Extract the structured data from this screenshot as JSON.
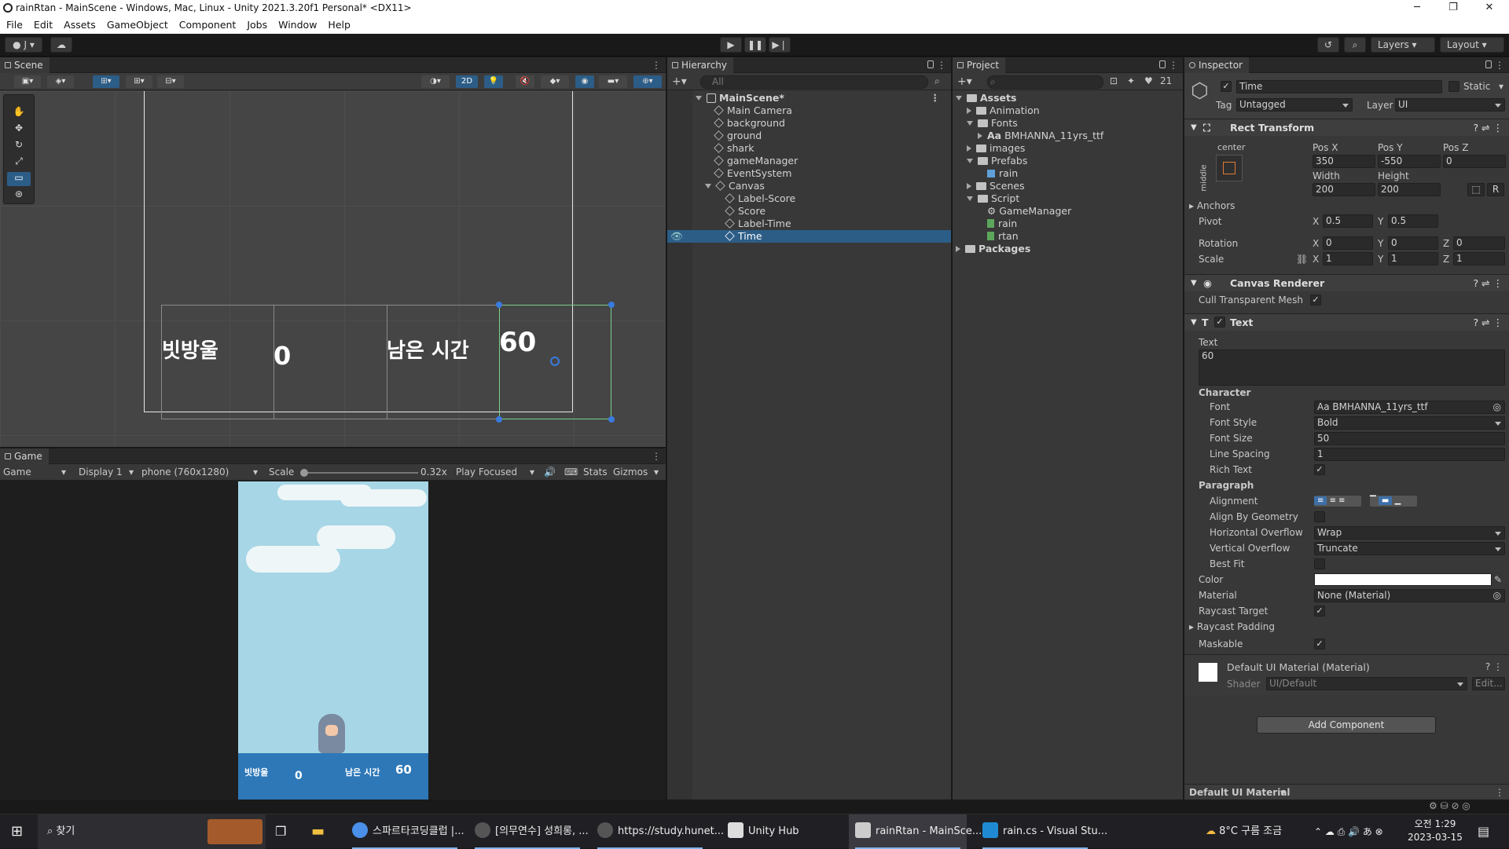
{
  "window": {
    "title": "rainRtan - MainScene - Windows, Mac, Linux - Unity 2021.3.20f1 Personal* <DX11>",
    "min": "─",
    "max": "❐",
    "close": "✕"
  },
  "menu": [
    "File",
    "Edit",
    "Assets",
    "GameObject",
    "Component",
    "Jobs",
    "Window",
    "Help"
  ],
  "toolbar": {
    "account": "J",
    "layers": "Layers",
    "layout": "Layout"
  },
  "scene": {
    "tab": "Scene",
    "mode2d": "2D",
    "labels": {
      "score_label": "빗방울",
      "score": "0",
      "time_label": "남은 시간",
      "time": "60"
    }
  },
  "game": {
    "tab": "Game",
    "view": "Game",
    "display": "Display 1",
    "resolution": "phone (760x1280)",
    "scale_label": "Scale",
    "scale_value": "0.32x",
    "play_mode": "Play Focused",
    "stats": "Stats",
    "gizmos": "Gizmos",
    "score_label": "빗방울",
    "score": "0",
    "time_label": "남은 시간",
    "time": "60"
  },
  "hierarchy": {
    "tab": "Hierarchy",
    "search_placeholder": "All",
    "scene": "MainScene*",
    "items": [
      "Main Camera",
      "background",
      "ground",
      "shark",
      "gameManager",
      "EventSystem",
      "Canvas",
      "Label-Score",
      "Score",
      "Label-Time",
      "Time"
    ]
  },
  "project": {
    "tab": "Project",
    "hidden_count": "21",
    "items": [
      "Assets",
      "Animation",
      "Fonts",
      "BMHANNA_11yrs_ttf",
      "images",
      "Prefabs",
      "rain",
      "Scenes",
      "Script",
      "GameManager",
      "rain",
      "rtan",
      "Packages"
    ]
  },
  "inspector": {
    "tab": "Inspector",
    "name": "Time",
    "static": "Static",
    "tag_label": "Tag",
    "tag": "Untagged",
    "layer_label": "Layer",
    "layer": "UI",
    "rect_transform": {
      "title": "Rect Transform",
      "anchor": "center",
      "side": "middle",
      "posx_label": "Pos X",
      "posy_label": "Pos Y",
      "posz_label": "Pos Z",
      "posx": "350",
      "posy": "-550",
      "posz": "0",
      "width_label": "Width",
      "height_label": "Height",
      "width": "200",
      "height": "200",
      "r": "R",
      "anchors": "Anchors",
      "pivot": "Pivot",
      "pivot_x": "0.5",
      "pivot_y": "0.5",
      "rotation": "Rotation",
      "rot_x": "0",
      "rot_y": "0",
      "rot_z": "0",
      "scale": "Scale",
      "scale_x": "1",
      "scale_y": "1",
      "scale_z": "1",
      "x": "X",
      "y": "Y",
      "z": "Z"
    },
    "canvas_renderer": {
      "title": "Canvas Renderer",
      "cull": "Cull Transparent Mesh"
    },
    "text": {
      "title": "Text",
      "text_label": "Text",
      "text": "60",
      "character": "Character",
      "font_label": "Font",
      "font": "BMHANNA_11yrs_ttf",
      "font_style_label": "Font Style",
      "font_style": "Bold",
      "font_size_label": "Font Size",
      "font_size": "50",
      "line_spacing_label": "Line Spacing",
      "line_spacing": "1",
      "rich_text": "Rich Text",
      "paragraph": "Paragraph",
      "alignment": "Alignment",
      "align_geom": "Align By Geometry",
      "hover_label": "Horizontal Overflow",
      "hover": "Wrap",
      "vover_label": "Vertical Overflow",
      "vover": "Truncate",
      "best_fit": "Best Fit",
      "color_label": "Color",
      "color": "#ffffff",
      "material_label": "Material",
      "material": "None (Material)",
      "raycast_target": "Raycast Target",
      "raycast_padding": "Raycast Padding",
      "maskable": "Maskable"
    },
    "material": {
      "title": "Default UI Material (Material)",
      "shader_label": "Shader",
      "shader": "UI/Default",
      "edit": "Edit..."
    },
    "add_component": "Add Component",
    "footer": "Default UI Material"
  },
  "taskbar": {
    "search": "찾기",
    "items": [
      "스파르타코딩클럽 |...",
      "[의무연수] 성희롱, ...",
      "https://study.hunet...",
      "Unity Hub",
      "rainRtan - MainSce...",
      "rain.cs - Visual Stu..."
    ],
    "weather": "8°C 구름 조금",
    "time": "오전 1:29",
    "date": "2023-03-15"
  }
}
